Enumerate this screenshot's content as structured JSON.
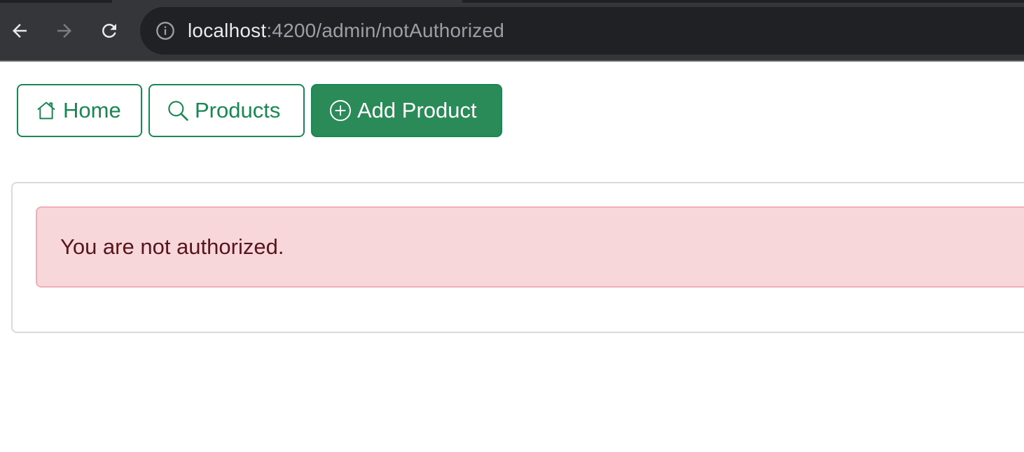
{
  "browser": {
    "url_host": "localhost",
    "url_path": ":4200/admin/notAuthorized",
    "icons": {
      "back": "arrow-left-icon",
      "forward": "arrow-right-icon",
      "reload": "reload-icon",
      "site_info": "info-circle-icon"
    }
  },
  "nav": {
    "home_label": "Home",
    "products_label": "Products",
    "add_product_label": "Add Product",
    "icons": {
      "home": "house-icon",
      "products": "search-icon",
      "add_product": "plus-circle-icon"
    }
  },
  "alert": {
    "message": "You are not authorized."
  },
  "colors": {
    "brand_green": "#198754",
    "add_button_bg": "#2a8a58",
    "alert_bg": "#f8d7da",
    "alert_border": "#f1aeb5",
    "alert_text": "#58151c",
    "chrome_bg": "#35363a",
    "omnibox_bg": "#202124"
  }
}
